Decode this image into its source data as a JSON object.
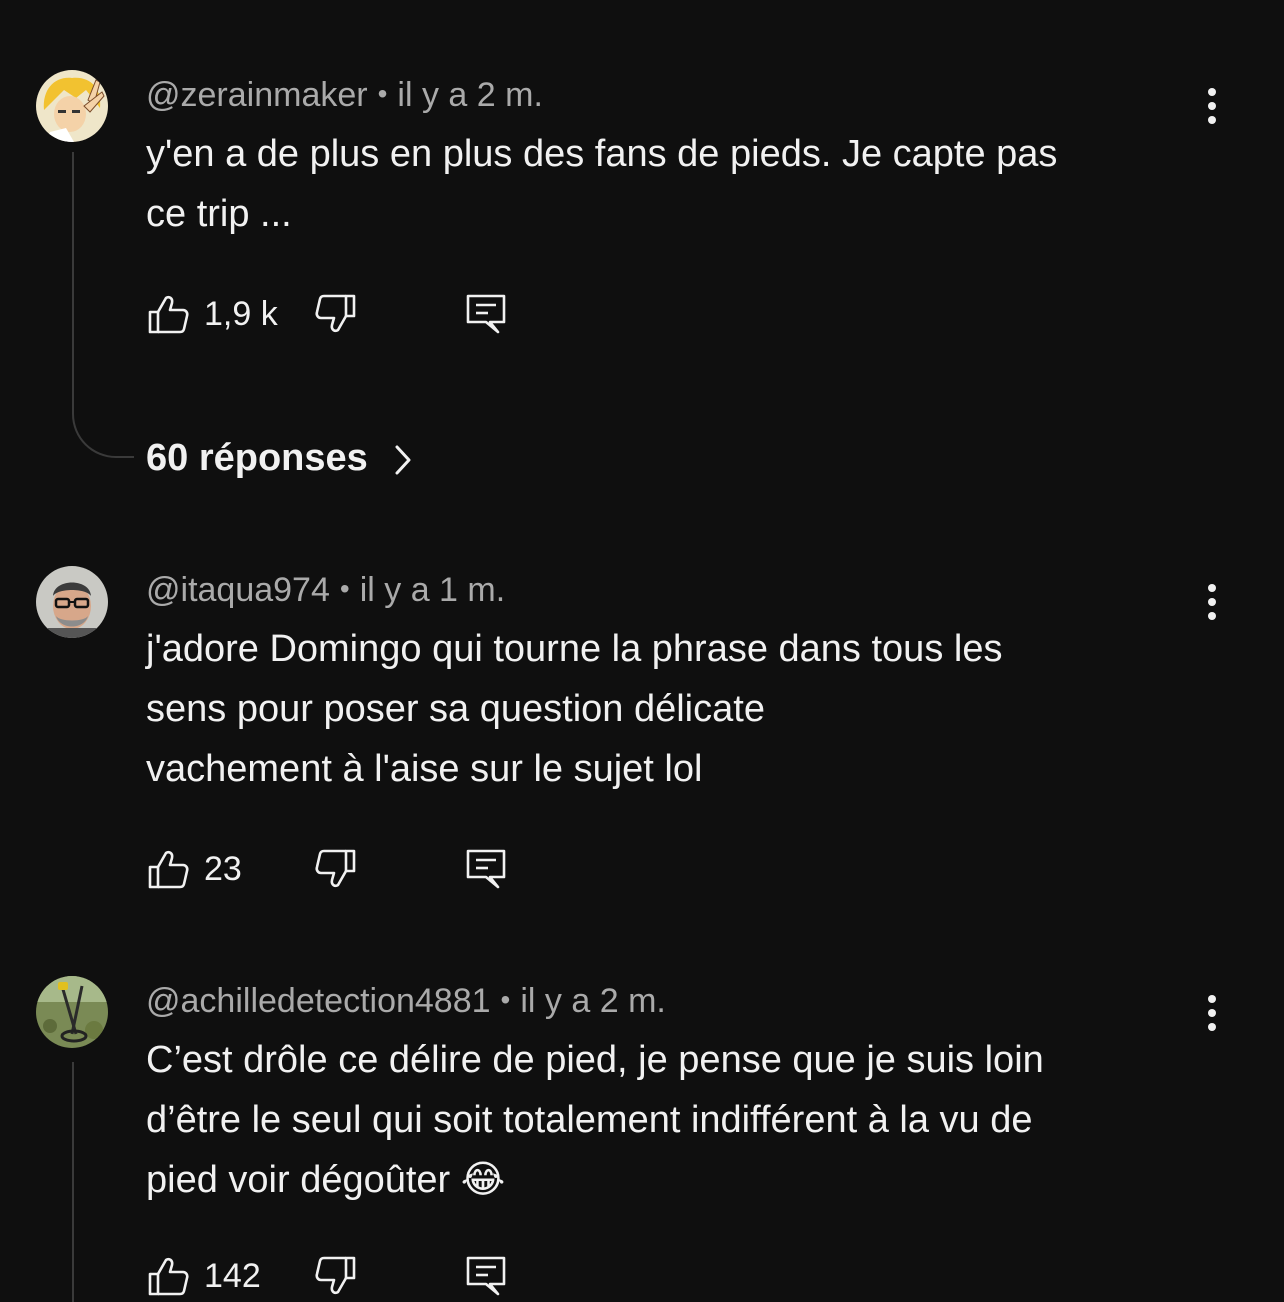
{
  "comments": [
    {
      "author": "@zerainmaker",
      "time": "il y a 2 m.",
      "lines": [
        "y'en a de plus en plus des fans de pieds. Je capte pas",
        "ce trip ..."
      ],
      "likes": "1,9 k",
      "replies_label": "60 réponses"
    },
    {
      "author": "@itaqua974",
      "time": "il y a 1 m.",
      "lines": [
        "j'adore  Domingo qui tourne la phrase dans tous les",
        "sens pour poser sa question délicate",
        "vachement à l'aise sur le sujet lol"
      ],
      "likes": "23"
    },
    {
      "author": "@achilledetection4881",
      "time": "il y a 2 m.",
      "lines": [
        "C’est drôle ce délire de pied, je pense que je suis loin",
        "d’être le seul qui soit totalement indifférent à la vu de",
        "pied voir dégoûter 😂"
      ],
      "likes": "142"
    }
  ],
  "separator": "•",
  "icons": {
    "like": "thumbs-up-icon",
    "dislike": "thumbs-down-icon",
    "reply": "comment-reply-icon",
    "more": "more-vertical-icon",
    "chevron": "chevron-right-icon"
  },
  "colors": {
    "background": "#0f0f0f",
    "text": "#f1f1f1",
    "meta": "#aaaaaa",
    "thread": "#3a3a3a"
  }
}
